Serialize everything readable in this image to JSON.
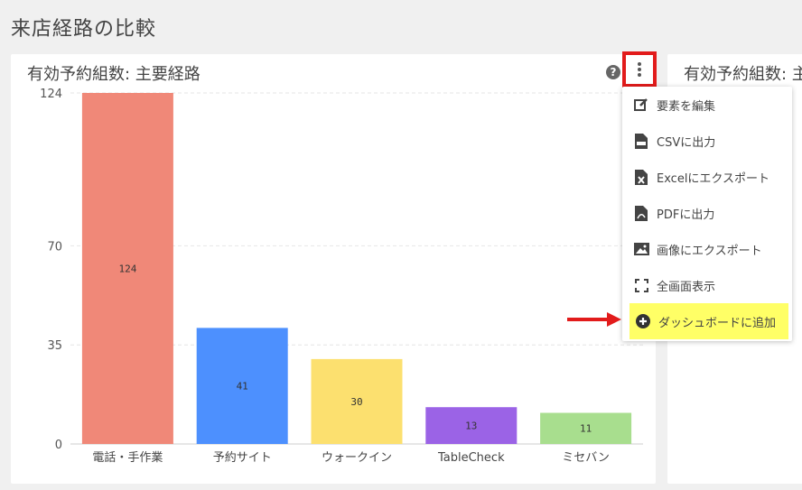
{
  "page": {
    "title": "来店経路の比較"
  },
  "card_main": {
    "title": "有効予約組数: 主要経路",
    "help_icon": "?"
  },
  "card_second": {
    "title": "有効予約組数: 主"
  },
  "menu": {
    "items": [
      {
        "label": "要素を編集",
        "icon": "edit-icon"
      },
      {
        "label": "CSVに出力",
        "icon": "csv-file-icon"
      },
      {
        "label": "Excelにエクスポート",
        "icon": "excel-file-icon"
      },
      {
        "label": "PDFに出力",
        "icon": "pdf-file-icon"
      },
      {
        "label": "画像にエクスポート",
        "icon": "image-icon"
      },
      {
        "label": "全画面表示",
        "icon": "fullscreen-icon"
      },
      {
        "label": "ダッシュボードに追加",
        "icon": "plus-circle-icon"
      }
    ],
    "highlight_color": "#ffff66"
  },
  "annotation": {
    "arrow_color": "#e21b1b"
  },
  "chart_data": {
    "type": "bar",
    "categories": [
      "電話・手作業",
      "予約サイト",
      "ウォークイン",
      "TableCheck",
      "ミセバン"
    ],
    "values": [
      124,
      41,
      30,
      13,
      11
    ],
    "data_labels": [
      "124",
      "41",
      "30",
      "13",
      "11"
    ],
    "colors": [
      "#f08878",
      "#4d90fe",
      "#fce06f",
      "#9b63e6",
      "#a8de8e"
    ],
    "yticks": [
      "0",
      "35",
      "70",
      "124"
    ],
    "ylim": [
      0,
      124
    ],
    "grid": true,
    "title": "",
    "xlabel": "",
    "ylabel": ""
  }
}
